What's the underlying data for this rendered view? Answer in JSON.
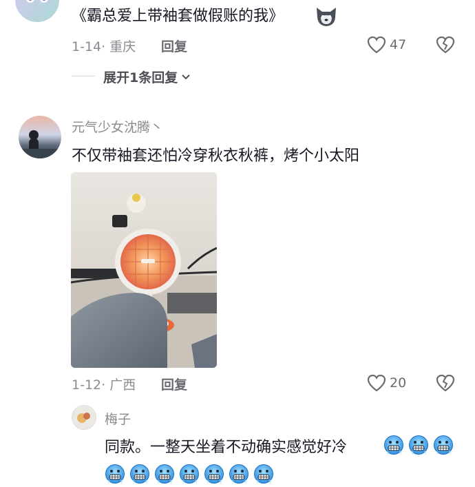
{
  "comments": [
    {
      "text": "《霸总爱上带袖套做假账的我》",
      "date": "1-14",
      "location": "重庆",
      "reply_label": "回复",
      "likes": "47",
      "expand_label": "展开1条回复"
    },
    {
      "username": "元气少女沈腾丶",
      "text": "不仅带袖套还怕冷穿秋衣秋裤，烤个小太阳",
      "date": "1-12",
      "location": "广西",
      "reply_label": "回复",
      "likes": "20"
    }
  ],
  "reply": {
    "username": "梅子",
    "text": "同款。一整天坐着不动确实感觉好冷",
    "emoji_icon": "cold-face-emoji-icon"
  },
  "colors": {
    "text": "#161823",
    "muted": "#8a8b91",
    "heater": "#f08a50"
  }
}
